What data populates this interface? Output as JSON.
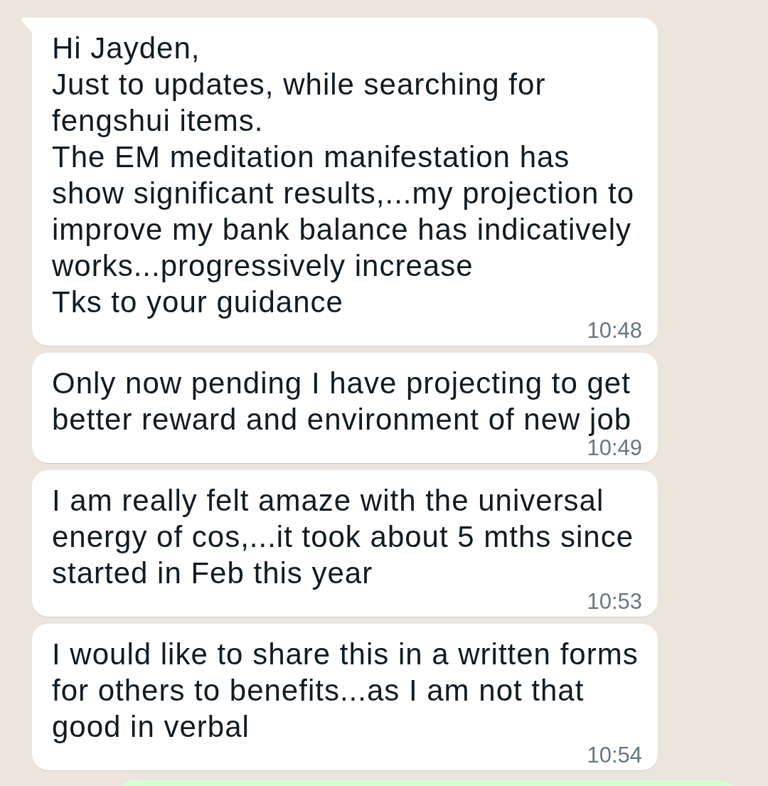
{
  "messages": [
    {
      "kind": "incoming",
      "tail": true,
      "text": "Hi Jayden,\nJust to updates, while searching for fengshui items.\nThe EM meditation manifestation has show significant results,...my projection to improve my bank balance has indicatively works...progressively increase\nTks to your guidance",
      "time": "10:48"
    },
    {
      "kind": "incoming",
      "tail": false,
      "text": "Only now pending I have projecting to get better reward and environment of new job",
      "time": "10:49"
    },
    {
      "kind": "incoming",
      "tail": false,
      "text": "I am really felt amaze with the universal energy of cos,...it took about 5 mths since started in Feb this year",
      "time": "10:53"
    },
    {
      "kind": "incoming",
      "tail": false,
      "text": "I would like to share this in a written forms for others to benefits...as I am not that good in verbal",
      "time": "10:54"
    },
    {
      "kind": "outgoing",
      "tail": false
    }
  ]
}
